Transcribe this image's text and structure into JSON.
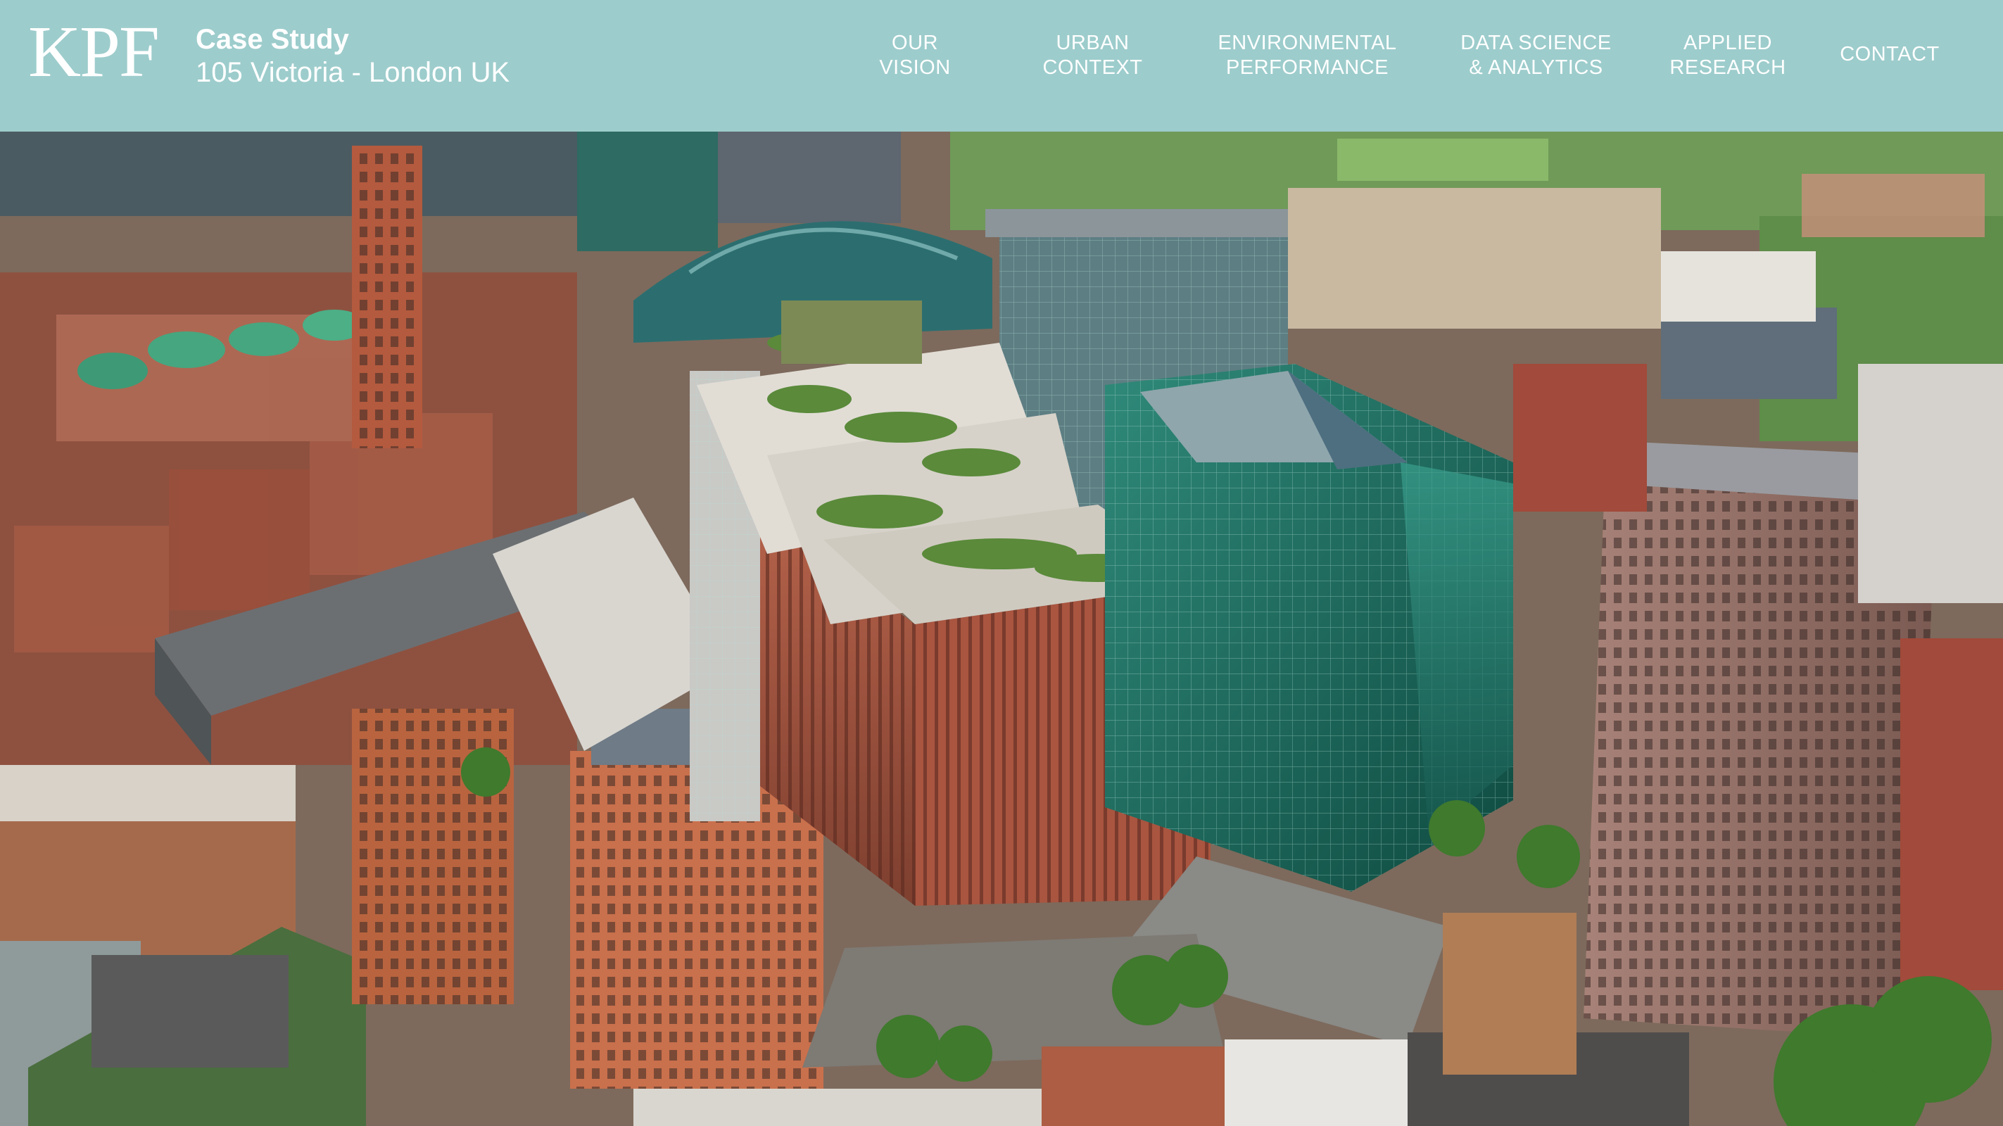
{
  "header": {
    "logo": "KPF",
    "case_study_label": "Case Study",
    "project_name": "105 Victoria - London UK"
  },
  "nav": {
    "items": [
      {
        "line1": "OUR",
        "line2": "VISION"
      },
      {
        "line1": "URBAN",
        "line2": "CONTEXT"
      },
      {
        "line1": "ENVIRONMENTAL",
        "line2": "PERFORMANCE"
      },
      {
        "line1": "DATA SCIENCE",
        "line2": "& ANALYTICS"
      },
      {
        "line1": "APPLIED",
        "line2": "RESEARCH"
      },
      {
        "line1": "CONTACT",
        "line2": ""
      }
    ]
  },
  "colors": {
    "header_bg": "#9dcccc",
    "header_text": "#ffffff"
  }
}
